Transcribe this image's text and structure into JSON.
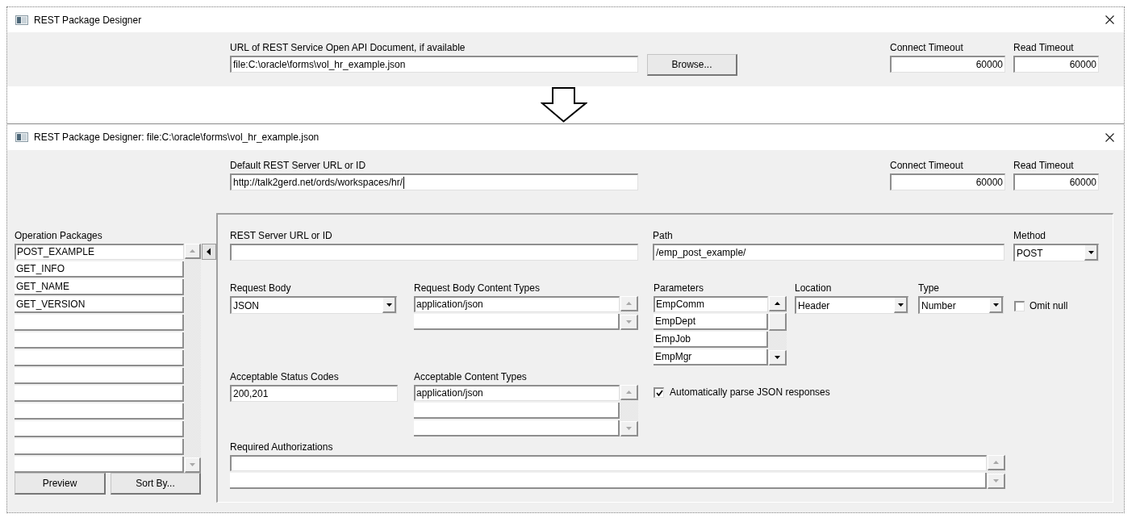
{
  "before_window": {
    "title": "REST Package Designer",
    "open_api_url": {
      "label": "URL of REST Service Open API Document, if available",
      "value": "file:C:\\oracle\\forms\\vol_hr_example.json"
    },
    "browse_button": {
      "label": "Browse..."
    },
    "connect_timeout": {
      "label": "Connect Timeout",
      "value": "60000"
    },
    "read_timeout": {
      "label": "Read Timeout",
      "value": "60000"
    }
  },
  "after_window": {
    "title": "REST Package Designer: file:C:\\oracle\\forms\\vol_hr_example.json",
    "default_server": {
      "label": "Default REST Server URL or ID",
      "value": "http://talk2gerd.net/ords/workspaces/hr/",
      "focused": true
    },
    "connect_timeout": {
      "label": "Connect Timeout",
      "value": "60000"
    },
    "read_timeout": {
      "label": "Read Timeout",
      "value": "60000"
    },
    "operation_packages": {
      "label": "Operation Packages",
      "items": [
        {
          "value": "POST_EXAMPLE",
          "selected": true
        },
        {
          "value": "GET_INFO",
          "selected": false
        },
        {
          "value": "GET_NAME",
          "selected": false
        },
        {
          "value": "GET_VERSION",
          "selected": false
        },
        {
          "selected": false
        },
        {
          "selected": false
        },
        {
          "selected": false
        },
        {
          "selected": false
        },
        {
          "selected": false
        },
        {
          "selected": false
        },
        {
          "selected": false
        },
        {
          "selected": false
        },
        {
          "selected": false
        }
      ],
      "scrollbar": {
        "enabled": false
      }
    },
    "preview_button": {
      "label": "Preview"
    },
    "sort_button": {
      "label": "Sort By..."
    },
    "operation": {
      "server": {
        "label": "REST Server URL or ID"
      },
      "path": {
        "label": "Path",
        "value": "/emp_post_example/"
      },
      "method": {
        "label": "Method",
        "value": "POST"
      },
      "request_body": {
        "label": "Request Body",
        "value": "JSON"
      },
      "request_content_types": {
        "label": "Request Body Content Types",
        "items": [
          {
            "value": "application/json",
            "selected": true
          },
          {
            "selected": false
          }
        ],
        "scrollbar": {
          "enabled": false
        }
      },
      "parameters": {
        "label": "Parameters",
        "items": [
          {
            "value": "EmpComm",
            "selected": true
          },
          {
            "value": "EmpDept",
            "selected": false
          },
          {
            "value": "EmpJob",
            "selected": false
          },
          {
            "value": "EmpMgr",
            "selected": false
          }
        ],
        "scrollbar": {
          "enabled": true
        }
      },
      "location": {
        "label": "Location",
        "value": "Header"
      },
      "type": {
        "label": "Type",
        "value": "Number"
      },
      "omit_null": {
        "label": "Omit null",
        "checked": false
      },
      "status_codes": {
        "label": "Acceptable Status Codes",
        "value": "200,201"
      },
      "acceptable_content_types": {
        "label": "Acceptable Content Types",
        "items": [
          {
            "value": "application/json",
            "selected": true
          },
          {
            "selected": false
          },
          {
            "selected": false
          }
        ],
        "scrollbar": {
          "enabled": false
        }
      },
      "auto_parse_json": {
        "label": "Automatically parse JSON responses",
        "checked": true
      },
      "required_authorizations": {
        "label": "Required Authorizations",
        "items": [
          {
            "selected": true
          },
          {
            "selected": false
          }
        ],
        "scrollbar": {
          "enabled": false
        }
      }
    }
  }
}
